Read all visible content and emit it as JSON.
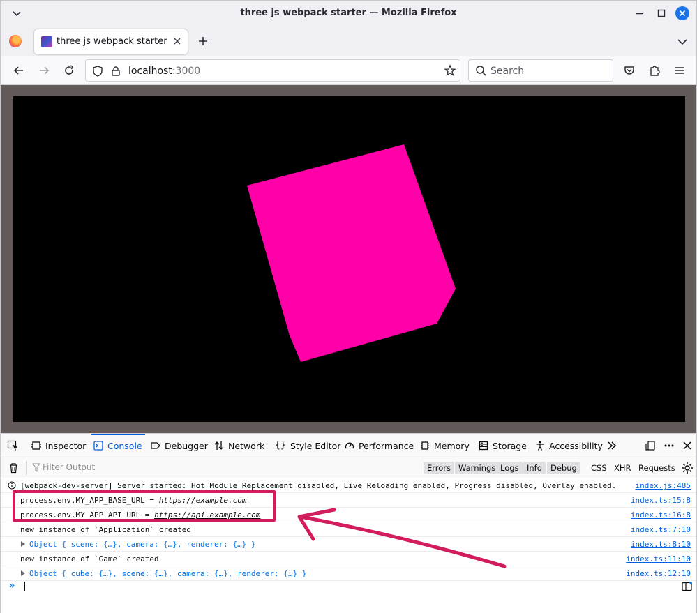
{
  "window": {
    "title": "three js webpack starter — Mozilla Firefox"
  },
  "tab": {
    "label": "three js webpack starter"
  },
  "navbar": {
    "url_host": "localhost",
    "url_port": ":3000",
    "search_placeholder": "Search"
  },
  "scene": {
    "background_color": "#000000",
    "cube_color": "#ff00a8"
  },
  "devtools": {
    "tabs": [
      {
        "label": "Inspector",
        "icon": "inspector-icon"
      },
      {
        "label": "Console",
        "icon": "console-icon",
        "active": true
      },
      {
        "label": "Debugger",
        "icon": "debugger-icon"
      },
      {
        "label": "Network",
        "icon": "network-icon"
      },
      {
        "label": "Style Editor",
        "icon": "style-editor-icon"
      },
      {
        "label": "Performance",
        "icon": "performance-icon"
      },
      {
        "label": "Memory",
        "icon": "memory-icon"
      },
      {
        "label": "Storage",
        "icon": "storage-icon"
      },
      {
        "label": "Accessibility",
        "icon": "accessibility-icon"
      }
    ],
    "filter_placeholder": "Filter Output",
    "levels": [
      "Errors",
      "Warnings",
      "Logs",
      "Info",
      "Debug"
    ],
    "extra_filters": [
      "CSS",
      "XHR",
      "Requests"
    ],
    "messages": [
      {
        "text": "[webpack-dev-server] Server started: Hot Module Replacement disabled, Live Reloading enabled, Progress disabled, Overlay enabled.",
        "source": "index.js:485"
      },
      {
        "text": "process.env.MY_APP_BASE_URL = ",
        "link": "https://example.com",
        "source": "index.ts:15:8"
      },
      {
        "text": "process.env.MY_APP_API_URL = ",
        "link": "https://api.example.com",
        "source": "index.ts:16:8"
      },
      {
        "text": "new instance of `Application` created",
        "source": "index.ts:7:10"
      },
      {
        "text": "Object { scene: {…}, camera: {…}, renderer: {…} }",
        "source": "index.ts:8:10"
      },
      {
        "text": "new instance of `Game` created",
        "source": "index.ts:11:10"
      },
      {
        "text": "Object { cube: {…}, scene: {…}, camera: {…}, renderer: {…} }",
        "source": "index.ts:12:10"
      }
    ],
    "prompt": "»"
  },
  "annotation": {
    "color": "#d21c5e"
  }
}
